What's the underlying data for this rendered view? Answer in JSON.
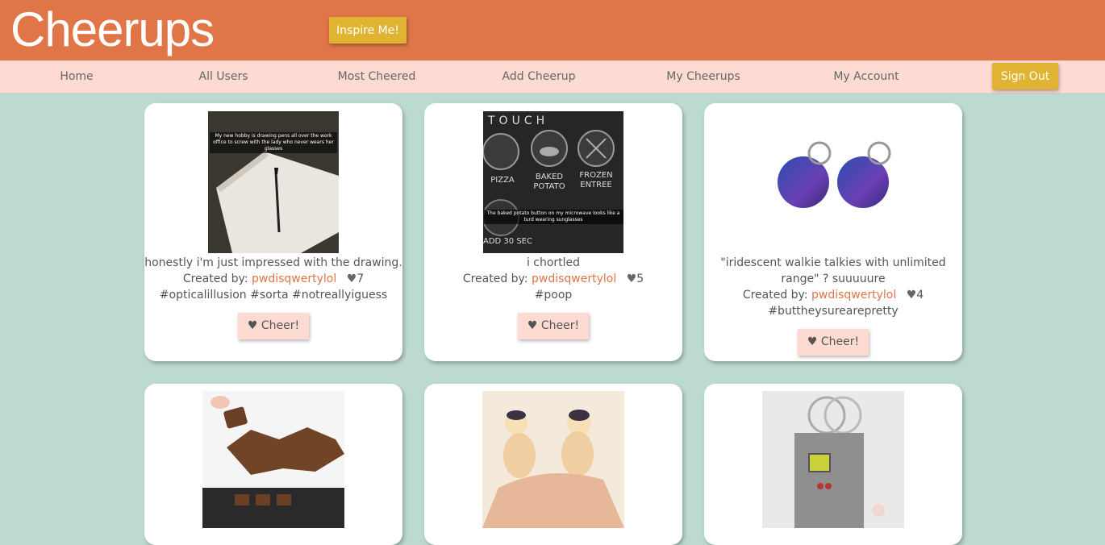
{
  "header": {
    "logo": "Cheerups",
    "inspire_label": "Inspire Me!"
  },
  "nav": {
    "items": [
      "Home",
      "All Users",
      "Most Cheered",
      "Add Cheerup",
      "My Cheerups",
      "My Account"
    ],
    "signout_label": "Sign Out"
  },
  "cards": [
    {
      "caption": "honestly i'm just impressed with the drawing.",
      "created_by": "Created by:",
      "author": "pwdisqwertylol",
      "count": "7",
      "tags": "#opticalillusion #sorta #notreallyiguess",
      "cheer": "♥ Cheer!",
      "img_text": "My new hobby is drawing pens all over the work office to screw with the lady who never wears her glasses"
    },
    {
      "caption": "i chortled",
      "created_by": "Created by:",
      "author": "pwdisqwertylol",
      "count": "5",
      "tags": "#poop",
      "cheer": "♥ Cheer!",
      "img_text": "The baked potato button on my microwave looks like a turd wearing sunglasses",
      "img_touch": "TOUCH",
      "img_labels": [
        "PIZZA",
        "BAKED POTATO",
        "FROZEN ENTREE",
        "ADD 30 SEC"
      ]
    },
    {
      "caption": "\"iridescent walkie talkies with unlimited range\" ? suuuuure",
      "created_by": "Created by:",
      "author": "pwdisqwertylol",
      "count": "4",
      "tags": "#buttheysurearepretty",
      "cheer": "♥ Cheer!"
    }
  ],
  "heart_icon": "♥"
}
